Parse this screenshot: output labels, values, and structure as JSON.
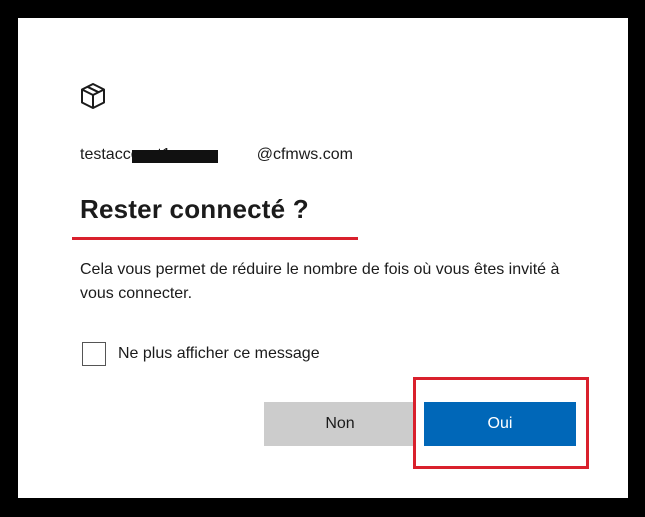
{
  "account": {
    "email": "testaccount1",
    "email_suffix": "@cfmws.com"
  },
  "title": "Rester connecté ?",
  "description": "Cela vous permet de réduire le nombre de fois où vous êtes invité à vous connecter.",
  "checkbox": {
    "label": "Ne plus afficher ce message",
    "checked": false
  },
  "buttons": {
    "no_label": "Non",
    "yes_label": "Oui"
  },
  "icons": {
    "logo": "package-icon"
  },
  "colors": {
    "primary": "#0067b8",
    "secondary_button": "#cccccc",
    "annotation": "#d9202c"
  }
}
